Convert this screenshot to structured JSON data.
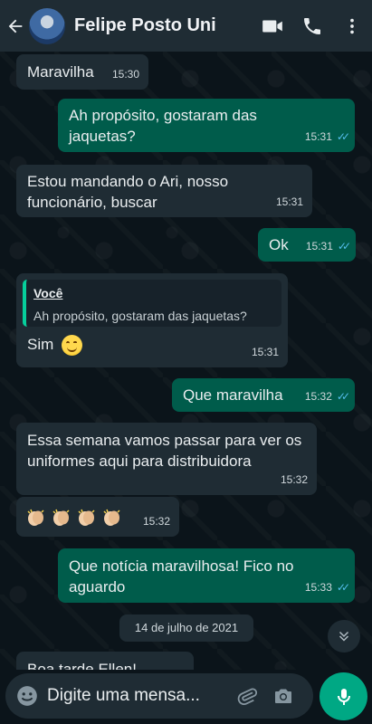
{
  "header": {
    "contact_name": "Felipe Posto Uni",
    "icons": [
      "back-arrow-icon",
      "video-call-icon",
      "voice-call-icon",
      "more-options-icon"
    ]
  },
  "messages": [
    {
      "dir": "in",
      "text": "Maravilha",
      "time": "15:30"
    },
    {
      "dir": "out",
      "text": "Ah propósito, gostaram das jaquetas?",
      "time": "15:31",
      "status": "read"
    },
    {
      "dir": "in",
      "text": "Estou mandando o Ari, nosso funcionário,  buscar",
      "time": "15:31"
    },
    {
      "dir": "out",
      "text": "Ok",
      "time": "15:31",
      "status": "read"
    },
    {
      "dir": "in",
      "quote_author": "Você",
      "quote_text": "Ah propósito, gostaram das jaquetas?",
      "text": "Sim",
      "emoji": "smiling-face-icon",
      "time": "15:31"
    },
    {
      "dir": "out",
      "text": "Que maravilha",
      "time": "15:32",
      "status": "read"
    },
    {
      "dir": "in",
      "text": "Essa semana vamos passar para ver os uniformes aqui para distribuidora",
      "time": "15:32"
    },
    {
      "dir": "in",
      "emoji": "clapping-hands-icon",
      "emoji_count": 4,
      "time": "15:32"
    },
    {
      "dir": "out",
      "text": "Que notícia maravilhosa! Fico no aguardo",
      "time": "15:33",
      "status": "read"
    },
    {
      "dir": "in",
      "text": "Boa tarde Ellen!",
      "time": ""
    }
  ],
  "date_divider": "14 de julho de 2021",
  "composer": {
    "placeholder": "Digite uma mensa...",
    "icons": [
      "emoji-icon",
      "attach-icon",
      "camera-icon",
      "mic-icon"
    ]
  },
  "colors": {
    "background": "#0b141a",
    "incoming_bubble": "#1f2c34",
    "outgoing_bubble": "#005c4b",
    "read_ticks": "#53bdeb",
    "accent": "#00a884"
  }
}
